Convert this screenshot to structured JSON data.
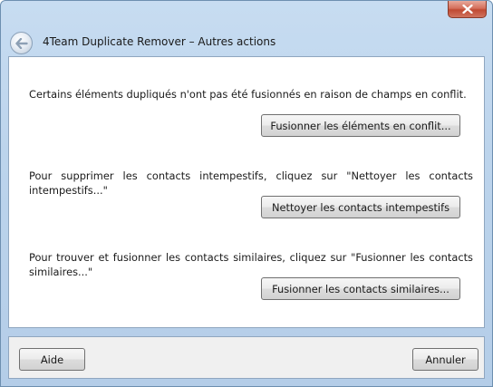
{
  "window": {
    "title": "4Team Duplicate Remover – Autres actions"
  },
  "sections": [
    {
      "message": "Certains éléments dupliqués n'ont pas été fusionnés en raison de champs en conflit.",
      "button_label": "Fusionner les éléments en conflit..."
    },
    {
      "message": "Pour supprimer les contacts intempestifs, cliquez sur \"Nettoyer les contacts intempestifs...\"",
      "button_label": "Nettoyer les contacts intempestifs"
    },
    {
      "message": "Pour trouver et fusionner les contacts similaires, cliquez sur \"Fusionner les contacts similaires...\"",
      "button_label": "Fusionner les contacts similaires..."
    }
  ],
  "footer": {
    "help_label": "Aide",
    "cancel_label": "Annuler"
  },
  "icons": {
    "close": "close-icon",
    "back": "back-arrow-icon"
  }
}
